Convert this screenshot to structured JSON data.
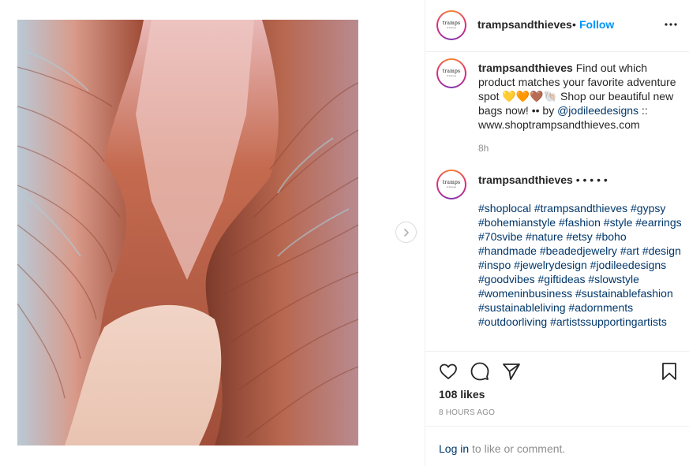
{
  "post": {
    "username": "trampsandthieves",
    "avatar_text": "tramps",
    "avatar_subtext": "& thieves",
    "follow_label": "Follow",
    "separator": "•"
  },
  "caption": {
    "username": "trampsandthieves",
    "text_before": "Find out which product matches your favorite adventure spot",
    "emoji": "💛🧡🤎🐚",
    "text_mid": "Shop our beautiful new bags now! •• by",
    "mention": "@jodileedesigns",
    "text_after": ":: www.shoptrampsandthieves.com",
    "time": "8h"
  },
  "comment": {
    "username": "trampsandthieves",
    "dots": "• • • • •",
    "hashtags": [
      "#shoplocal",
      "#trampsandthieves",
      "#gypsy",
      "#bohemianstyle",
      "#fashion",
      "#style",
      "#earrings",
      "#70svibe",
      "#nature",
      "#etsy",
      "#boho",
      "#handmade",
      "#beadedjewelry",
      "#art",
      "#design",
      "#inspo",
      "#jewelrydesign",
      "#jodileedesigns",
      "#goodvibes",
      "#giftideas",
      "#slowstyle",
      "#womeninbusiness",
      "#sustainablefashion",
      "#sustainableliving",
      "#adornments",
      "#outdoorliving",
      "#artistssupportingartists"
    ]
  },
  "engagement": {
    "likes": "108 likes",
    "age": "8 HOURS AGO"
  },
  "login": {
    "link": "Log in",
    "rest": "to like or comment."
  },
  "icons": {
    "like": "heart-icon",
    "comment": "comment-icon",
    "share": "share-icon",
    "save": "bookmark-icon",
    "more": "more-options-icon",
    "next": "chevron-right-icon"
  },
  "colors": {
    "accent": "#0095f6",
    "link": "#00376b",
    "muted": "#8e8e8e",
    "text": "#262626"
  }
}
